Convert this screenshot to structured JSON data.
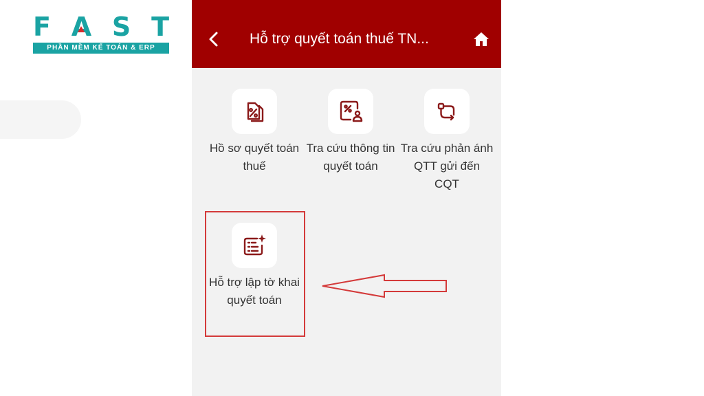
{
  "brand": {
    "letters": [
      "F",
      "A",
      "S",
      "T"
    ],
    "tagline": "PHẦN MỀM KẾ TOÁN & ERP",
    "color": "#1aa3a3",
    "accent": "#d62b2b"
  },
  "header": {
    "title": "Hỗ trợ quyết toán thuế TN...",
    "back_icon": "chevron-left-icon",
    "home_icon": "home-icon",
    "color": "#a00000"
  },
  "menu": {
    "items": [
      {
        "label": "Hồ sơ quyết toán thuế",
        "icon": "tax-document-icon"
      },
      {
        "label": "Tra cứu thông tin quyết toán",
        "icon": "tax-search-icon"
      },
      {
        "label": "Tra cứu phản ánh QTT gửi đến CQT",
        "icon": "route-icon"
      },
      {
        "label": "Hỗ trợ lập tờ khai quyết toán",
        "icon": "form-sparkle-icon"
      }
    ]
  },
  "annotation": {
    "color": "#d43a3a"
  }
}
